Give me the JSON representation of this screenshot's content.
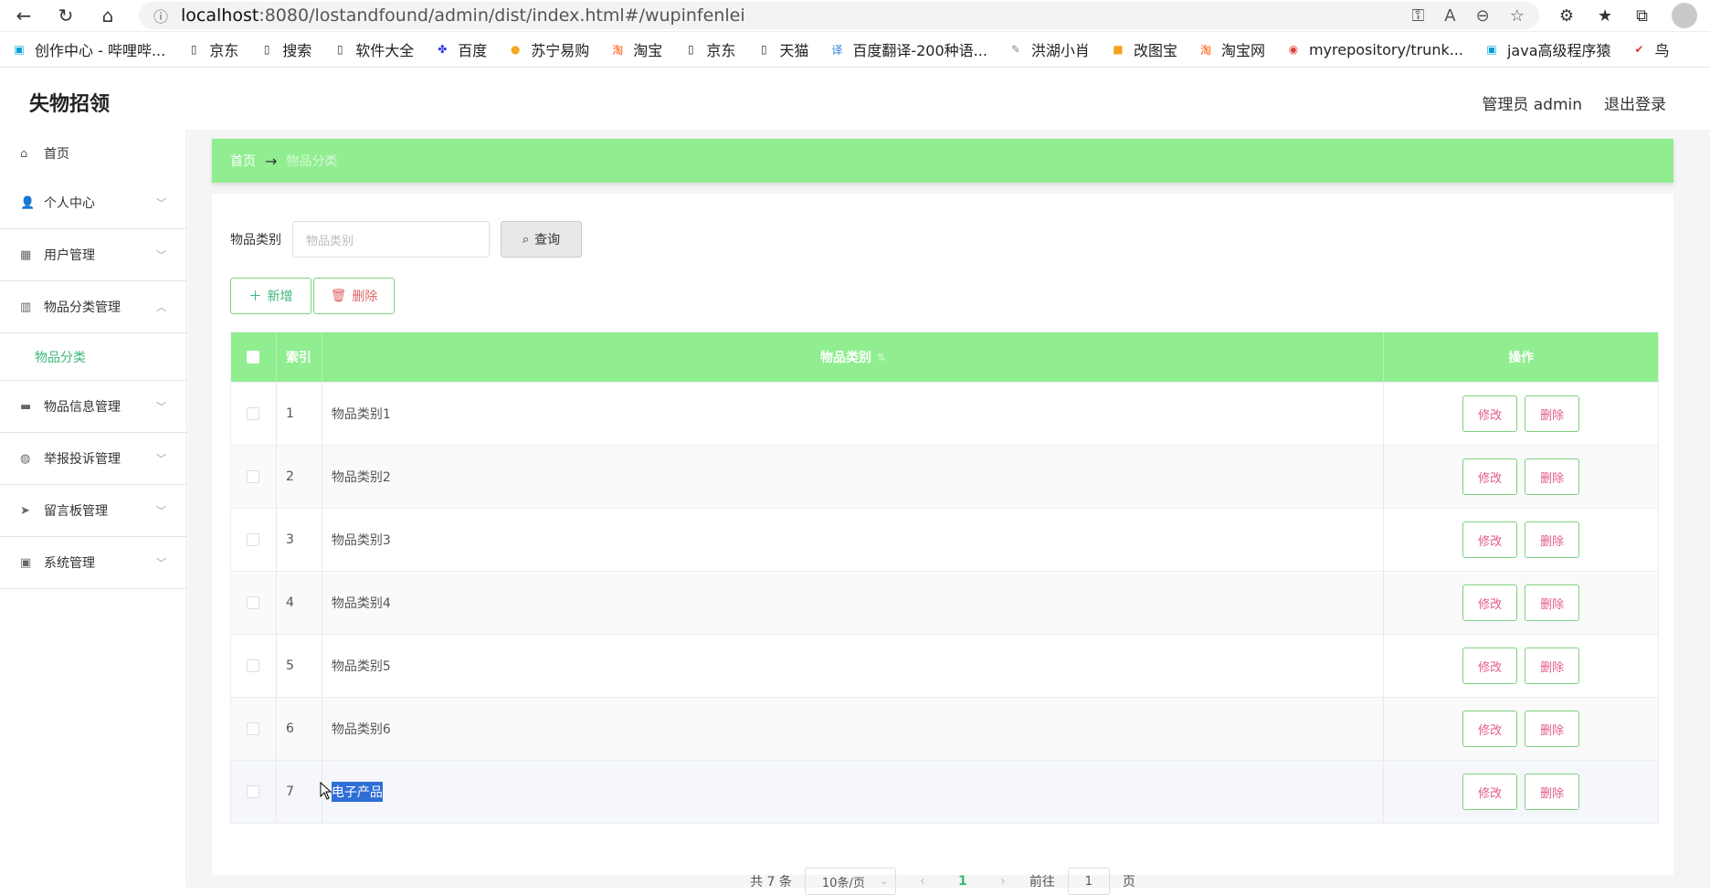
{
  "browser": {
    "url_host": "localhost",
    "url_path": ":8080/lostandfound/admin/dist/index.html#/wupinfenlei",
    "bookmarks": [
      {
        "label": "创作中心 - 哔哩哔...",
        "icon": "bilibili-icon",
        "color": "#00a1d6"
      },
      {
        "label": "京东",
        "icon": "page-icon",
        "color": "#333333"
      },
      {
        "label": "搜索",
        "icon": "page-icon",
        "color": "#333333"
      },
      {
        "label": "软件大全",
        "icon": "page-icon",
        "color": "#333333"
      },
      {
        "label": "百度",
        "icon": "baidu-icon",
        "color": "#2932e1"
      },
      {
        "label": "苏宁易购",
        "icon": "suning-icon",
        "color": "#f5a623"
      },
      {
        "label": "淘宝",
        "icon": "taobao-icon",
        "color": "#ff5000"
      },
      {
        "label": "京东",
        "icon": "page-icon",
        "color": "#333333"
      },
      {
        "label": "天猫",
        "icon": "page-icon",
        "color": "#333333"
      },
      {
        "label": "百度翻译-200种语...",
        "icon": "translate-icon",
        "color": "#2a7de1"
      },
      {
        "label": "洪湖小肖",
        "icon": "bird-icon",
        "color": "#888888"
      },
      {
        "label": "改图宝",
        "icon": "gaitubao-icon",
        "color": "#f7a21b"
      },
      {
        "label": "淘宝网",
        "icon": "taobao-icon",
        "color": "#ff5000"
      },
      {
        "label": "myrepository/trunk...",
        "icon": "chrome-icon",
        "color": "#db4437"
      },
      {
        "label": "java高级程序猿",
        "icon": "bilibili-icon",
        "color": "#00a1d6"
      },
      {
        "label": "鸟",
        "icon": "feishu-icon",
        "color": "#e33"
      }
    ]
  },
  "app": {
    "title": "失物招领",
    "user_label": "管理员 admin",
    "logout_label": "退出登录"
  },
  "sidebar": {
    "items": [
      {
        "label": "首页",
        "icon": "home-icon",
        "has_children": false
      },
      {
        "label": "个人中心",
        "icon": "user-icon",
        "has_children": true
      },
      {
        "label": "用户管理",
        "icon": "users-manage-icon",
        "has_children": true
      },
      {
        "label": "物品分类管理",
        "icon": "category-icon",
        "has_children": true,
        "expanded": true
      },
      {
        "label": "物品信息管理",
        "icon": "box-icon",
        "has_children": true
      },
      {
        "label": "举报投诉管理",
        "icon": "report-icon",
        "has_children": true
      },
      {
        "label": "留言板管理",
        "icon": "message-icon",
        "has_children": true
      },
      {
        "label": "系统管理",
        "icon": "system-icon",
        "has_children": true
      }
    ],
    "submenu_active": "物品分类"
  },
  "breadcrumb": {
    "home": "首页",
    "separator": "→",
    "current": "物品分类"
  },
  "search": {
    "label": "物品类别",
    "placeholder": "物品类别",
    "button_label": "查询"
  },
  "actions": {
    "add_label": "新增",
    "delete_label": "删除"
  },
  "table": {
    "headers": {
      "index": "索引",
      "category": "物品类别",
      "actions": "操作"
    },
    "edit_label": "修改",
    "delete_label": "删除",
    "rows": [
      {
        "index": "1",
        "category": "物品类别1"
      },
      {
        "index": "2",
        "category": "物品类别2"
      },
      {
        "index": "3",
        "category": "物品类别3"
      },
      {
        "index": "4",
        "category": "物品类别4"
      },
      {
        "index": "5",
        "category": "物品类别5"
      },
      {
        "index": "6",
        "category": "物品类别6"
      },
      {
        "index": "7",
        "category": "电子产品"
      }
    ]
  },
  "pager": {
    "total": "共 7 条",
    "page_size": "10条/页",
    "current_page": "1",
    "goto_label": "前往",
    "goto_value": "1",
    "page_unit": "页"
  },
  "colors": {
    "accent_green": "#90ee90",
    "text_green": "#3cb878",
    "danger": "#e06464"
  }
}
